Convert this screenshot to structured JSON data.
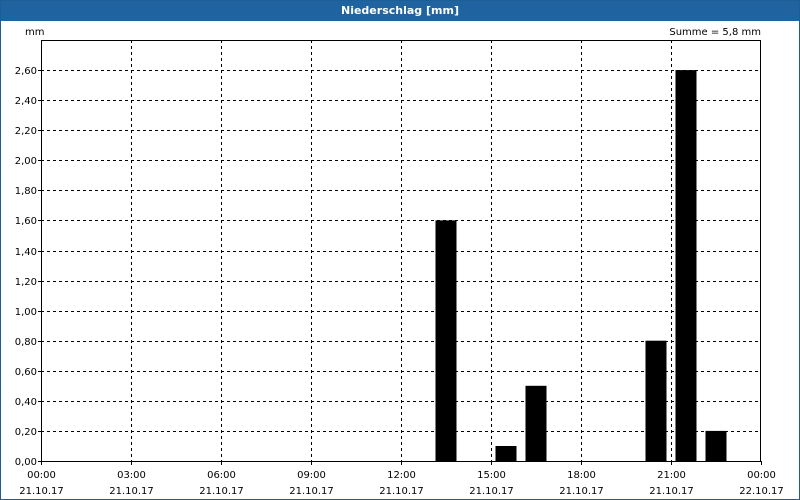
{
  "window": {
    "title": "Niederschlag [mm]"
  },
  "chart_data": {
    "type": "bar",
    "title": "Niederschlag [mm]",
    "ylabel": "mm",
    "summary": "Summe = 5,8 mm",
    "x_range_hours": [
      0,
      24
    ],
    "ylim": [
      0,
      2.8
    ],
    "y_ticks": [
      {
        "value": 0.0,
        "label": "0,00"
      },
      {
        "value": 0.2,
        "label": "0,20"
      },
      {
        "value": 0.4,
        "label": "0,40"
      },
      {
        "value": 0.6,
        "label": "0,60"
      },
      {
        "value": 0.8,
        "label": "0,80"
      },
      {
        "value": 1.0,
        "label": "1,00"
      },
      {
        "value": 1.2,
        "label": "1,20"
      },
      {
        "value": 1.4,
        "label": "1,40"
      },
      {
        "value": 1.6,
        "label": "1,60"
      },
      {
        "value": 1.8,
        "label": "1,80"
      },
      {
        "value": 2.0,
        "label": "2,00"
      },
      {
        "value": 2.2,
        "label": "2,20"
      },
      {
        "value": 2.4,
        "label": "2,40"
      },
      {
        "value": 2.6,
        "label": "2,60"
      }
    ],
    "x_ticks": [
      {
        "hour": 0,
        "time": "00:00",
        "date": "21.10.17"
      },
      {
        "hour": 3,
        "time": "03:00",
        "date": "21.10.17"
      },
      {
        "hour": 6,
        "time": "06:00",
        "date": "21.10.17"
      },
      {
        "hour": 9,
        "time": "09:00",
        "date": "21.10.17"
      },
      {
        "hour": 12,
        "time": "12:00",
        "date": "21.10.17"
      },
      {
        "hour": 15,
        "time": "15:00",
        "date": "21.10.17"
      },
      {
        "hour": 18,
        "time": "18:00",
        "date": "21.10.17"
      },
      {
        "hour": 21,
        "time": "21:00",
        "date": "21.10.17"
      },
      {
        "hour": 24,
        "time": "00:00",
        "date": "22.10.17"
      }
    ],
    "bars": [
      {
        "hour": 13,
        "value": 1.6
      },
      {
        "hour": 15,
        "value": 0.1
      },
      {
        "hour": 16,
        "value": 0.5
      },
      {
        "hour": 20,
        "value": 0.8
      },
      {
        "hour": 21,
        "value": 2.6
      },
      {
        "hour": 22,
        "value": 0.2
      }
    ],
    "grid": true,
    "bar_color": "#000000",
    "grid_color": "#000000"
  }
}
